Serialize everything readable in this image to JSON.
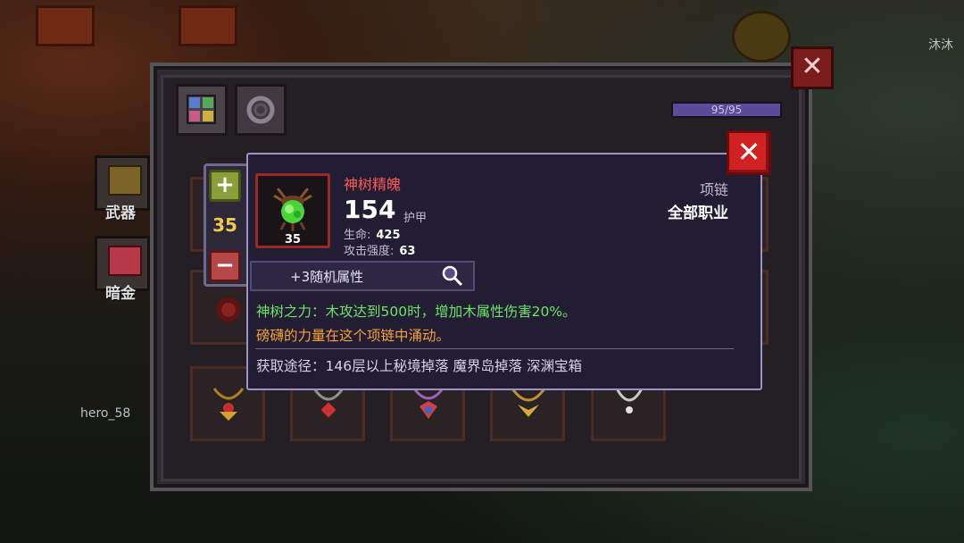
{
  "header": {
    "hp_text": "95/95",
    "hp_fraction": 1.0,
    "corner_name": "沐沐"
  },
  "sidebar": {
    "weapon_label": "武器",
    "dark_gold_label": "暗金"
  },
  "background": {
    "player_name": "hero_58"
  },
  "quantity": {
    "value": "35",
    "plus": "+",
    "minus": "−"
  },
  "tooltip": {
    "close": "✕",
    "item_name": "神树精魄",
    "item_level": "35",
    "armor_value": "154",
    "armor_label": "护甲",
    "stats": [
      {
        "label": "生命:",
        "value": "425"
      },
      {
        "label": "攻击强度:",
        "value": "63"
      }
    ],
    "slot_type": "项链",
    "class_type": "全部职业",
    "random_attr": "+3随机属性",
    "effect_line1": "神树之力：木攻达到500时，增加木属性伤害20%。",
    "effect_line2": "磅礴的力量在这个项链中涌动。",
    "source": "获取途径：146层以上秘境掉落 魔界岛掉落 深渊宝箱"
  },
  "panel": {
    "close": "✕"
  },
  "colors": {
    "item_name": "#ff5a5a",
    "effect_green": "#6fe36a",
    "effect_orange": "#f6a33a",
    "quantity_yellow": "#f2c94c",
    "close_red": "#d02222"
  }
}
